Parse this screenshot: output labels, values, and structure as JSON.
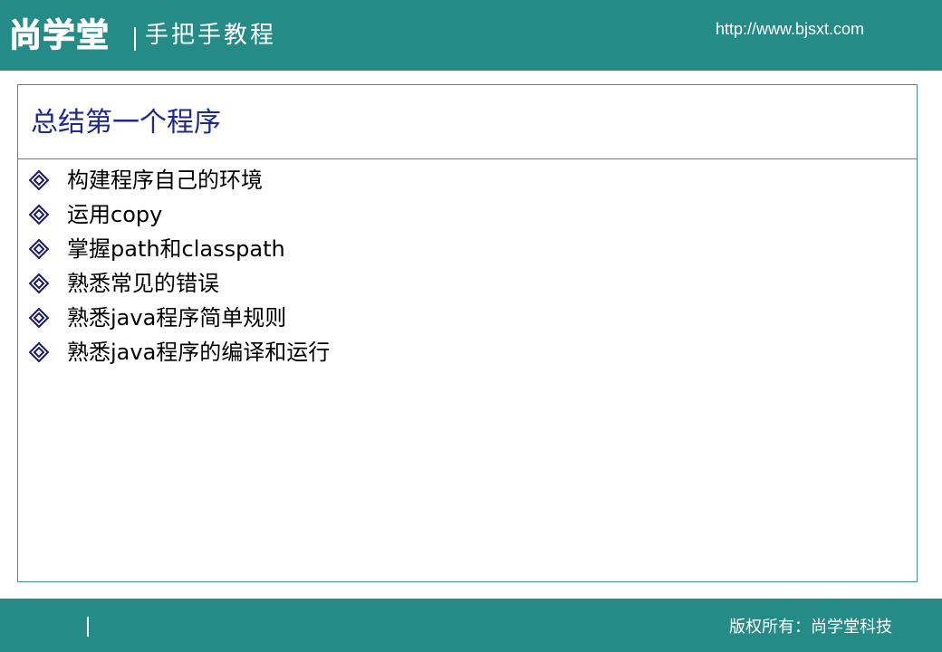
{
  "header": {
    "logo_text": "尚学堂",
    "tagline": "手把手教程",
    "url": "http://www.bjsxt.com"
  },
  "slide": {
    "title": "总结第一个程序",
    "bullets": [
      {
        "text": "构建程序自己的环境"
      },
      {
        "text": "运用copy"
      },
      {
        "text": "掌握path和classpath"
      },
      {
        "text": "熟悉常见的错误"
      },
      {
        "text": "熟悉java程序简单规则"
      },
      {
        "text": "熟悉java程序的编译和运行"
      }
    ]
  },
  "footer": {
    "copyright": "版权所有：尚学堂科技"
  },
  "colors": {
    "teal": "#248b87",
    "title_blue": "#1f2a8a",
    "bullet_navy": "#1a1a6e"
  },
  "icons": {
    "bullet": "diamond-bullet-icon"
  }
}
